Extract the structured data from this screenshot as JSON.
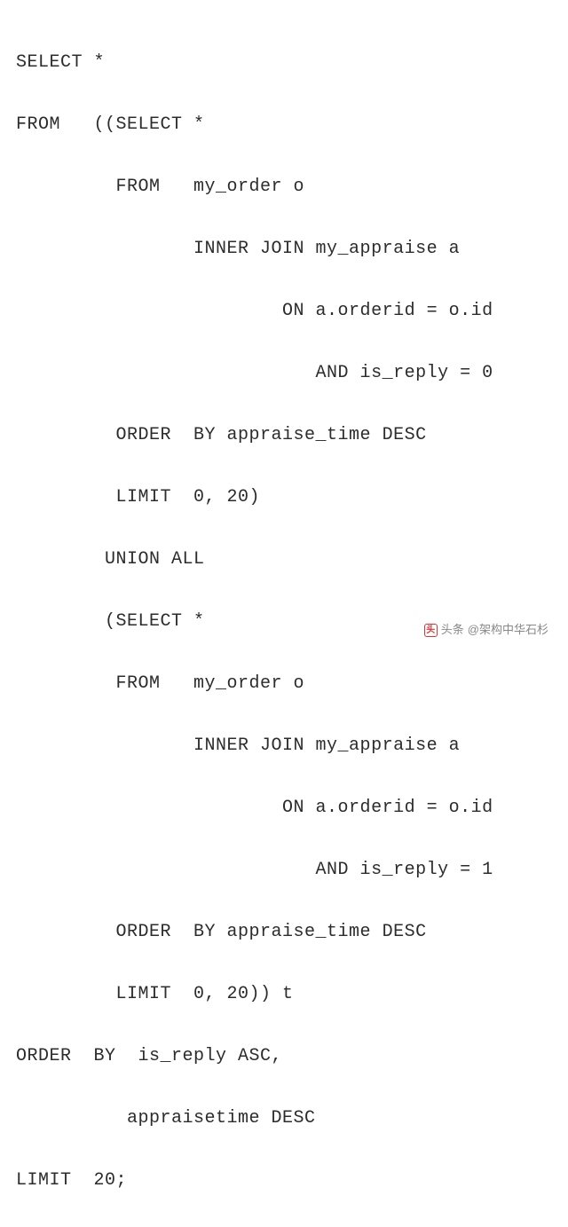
{
  "code": {
    "lines": [
      "SELECT *",
      "FROM   ((SELECT *",
      "         FROM   my_order o",
      "                INNER JOIN my_appraise a",
      "                        ON a.orderid = o.id",
      "                           AND is_reply = 0",
      "         ORDER  BY appraise_time DESC",
      "         LIMIT  0, 20)",
      "        UNION ALL",
      "        (SELECT *",
      "         FROM   my_order o",
      "                INNER JOIN my_appraise a",
      "                        ON a.orderid = o.id",
      "                           AND is_reply = 1",
      "         ORDER  BY appraise_time DESC",
      "         LIMIT  0, 20)) t",
      "ORDER  BY  is_reply ASC,",
      "          appraisetime DESC",
      "LIMIT  20;"
    ]
  },
  "watermark": {
    "prefix": "头条",
    "text": "@架构中华石杉",
    "icon_glyph": "头"
  }
}
